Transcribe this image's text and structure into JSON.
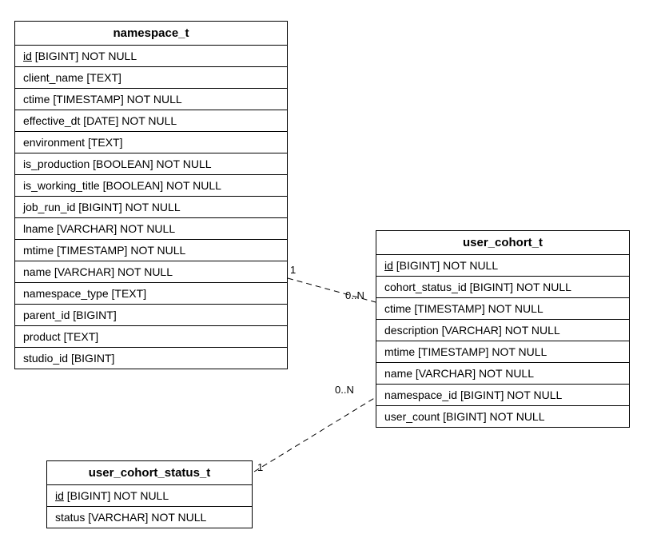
{
  "entities": {
    "namespace_t": {
      "title": "namespace_t",
      "fields": [
        {
          "name": "id",
          "type": "[BIGINT]",
          "constraint": "NOT NULL",
          "pk": true
        },
        {
          "name": "client_name",
          "type": "[TEXT]",
          "constraint": "",
          "pk": false
        },
        {
          "name": "ctime",
          "type": "[TIMESTAMP]",
          "constraint": "NOT NULL",
          "pk": false
        },
        {
          "name": "effective_dt",
          "type": "[DATE]",
          "constraint": "NOT NULL",
          "pk": false
        },
        {
          "name": "environment",
          "type": "[TEXT]",
          "constraint": "",
          "pk": false
        },
        {
          "name": "is_production",
          "type": "[BOOLEAN]",
          "constraint": "NOT NULL",
          "pk": false
        },
        {
          "name": "is_working_title",
          "type": "[BOOLEAN]",
          "constraint": "NOT NULL",
          "pk": false
        },
        {
          "name": "job_run_id",
          "type": "[BIGINT]",
          "constraint": "NOT NULL",
          "pk": false
        },
        {
          "name": "lname",
          "type": "[VARCHAR]",
          "constraint": "NOT NULL",
          "pk": false
        },
        {
          "name": "mtime",
          "type": "[TIMESTAMP]",
          "constraint": "NOT NULL",
          "pk": false
        },
        {
          "name": "name",
          "type": "[VARCHAR]",
          "constraint": "NOT NULL",
          "pk": false
        },
        {
          "name": "namespace_type",
          "type": "[TEXT]",
          "constraint": "",
          "pk": false
        },
        {
          "name": "parent_id",
          "type": "[BIGINT]",
          "constraint": "",
          "pk": false
        },
        {
          "name": "product",
          "type": "[TEXT]",
          "constraint": "",
          "pk": false
        },
        {
          "name": "studio_id",
          "type": "[BIGINT]",
          "constraint": "",
          "pk": false
        }
      ]
    },
    "user_cohort_t": {
      "title": "user_cohort_t",
      "fields": [
        {
          "name": "id",
          "type": "[BIGINT]",
          "constraint": "NOT NULL",
          "pk": true
        },
        {
          "name": "cohort_status_id",
          "type": "[BIGINT]",
          "constraint": "NOT NULL",
          "pk": false
        },
        {
          "name": "ctime",
          "type": "[TIMESTAMP]",
          "constraint": "NOT NULL",
          "pk": false
        },
        {
          "name": "description",
          "type": "[VARCHAR]",
          "constraint": "NOT NULL",
          "pk": false
        },
        {
          "name": "mtime",
          "type": "[TIMESTAMP]",
          "constraint": "NOT NULL",
          "pk": false
        },
        {
          "name": "name",
          "type": "[VARCHAR]",
          "constraint": "NOT NULL",
          "pk": false
        },
        {
          "name": "namespace_id",
          "type": "[BIGINT]",
          "constraint": "NOT NULL",
          "pk": false
        },
        {
          "name": "user_count",
          "type": "[BIGINT]",
          "constraint": "NOT NULL",
          "pk": false
        }
      ]
    },
    "user_cohort_status_t": {
      "title": "user_cohort_status_t",
      "fields": [
        {
          "name": "id",
          "type": "[BIGINT]",
          "constraint": "NOT NULL",
          "pk": true
        },
        {
          "name": "status",
          "type": "[VARCHAR]",
          "constraint": "NOT NULL",
          "pk": false
        }
      ]
    }
  },
  "relationships": [
    {
      "from": "namespace_t",
      "from_card": "1",
      "to": "user_cohort_t",
      "to_card": "0..N"
    },
    {
      "from": "user_cohort_status_t",
      "from_card": "1",
      "to": "user_cohort_t",
      "to_card": "0..N"
    }
  ],
  "labels": {
    "card_1_a": "1",
    "card_0n_a": "0..N",
    "card_1_b": "1",
    "card_0n_b": "0..N"
  }
}
